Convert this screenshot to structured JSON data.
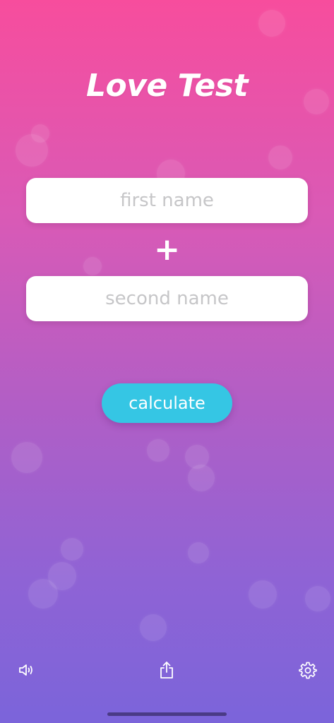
{
  "app": {
    "title": "Love Test"
  },
  "form": {
    "first_name": {
      "value": "",
      "placeholder": "first name"
    },
    "plus_symbol": "+",
    "second_name": {
      "value": "",
      "placeholder": "second name"
    },
    "calculate_label": "calculate"
  },
  "toolbar": {
    "left_icon": "speaker-icon",
    "center_icon": "share-icon",
    "right_icon": "gear-icon"
  },
  "colors": {
    "gradient_top": "#f74d9d",
    "gradient_bottom": "#7b64da",
    "button": "#35c6e4",
    "placeholder": "#c6c6c8"
  }
}
